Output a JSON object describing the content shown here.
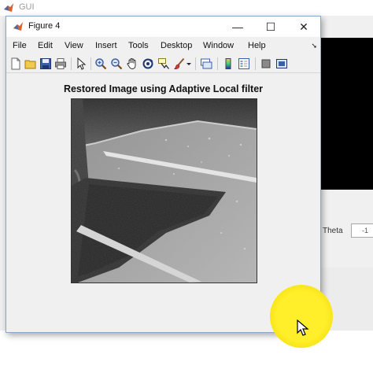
{
  "background_window": {
    "title": "GUI",
    "theta_label": "Theta",
    "theta_value": "-1"
  },
  "figure_window": {
    "title": "Figure 4",
    "controls": {
      "minimize": "—",
      "maximize": "☐",
      "close": "✕"
    },
    "menu": [
      "File",
      "Edit",
      "View",
      "Insert",
      "Tools",
      "Desktop",
      "Window",
      "Help"
    ],
    "menu_overflow": "➘",
    "toolbar_icons": [
      "new-figure-icon",
      "open-file-icon",
      "save-icon",
      "print-icon",
      "pointer-icon",
      "zoom-in-icon",
      "zoom-out-icon",
      "pan-icon",
      "rotate-3d-icon",
      "data-cursor-icon",
      "brush-icon",
      "link-plot-icon",
      "colorbar-icon",
      "legend-icon",
      "hide-plot-tools-icon",
      "show-plot-tools-icon"
    ],
    "axes_title": "Restored Image using Adaptive Local filter"
  },
  "colors": {
    "highlight": "#ffef2a",
    "window_border": "#8aa7c8",
    "figure_bg": "#f0f0f0"
  }
}
